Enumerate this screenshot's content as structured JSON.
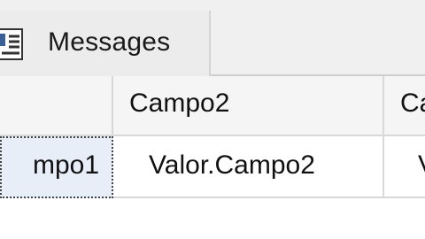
{
  "tabs": {
    "messages_label": "Messages",
    "icon": "messages-icon"
  },
  "results_grid": {
    "columns": [
      "",
      "Campo2",
      "Ca"
    ],
    "rows": [
      [
        "mpo1",
        "Valor.Campo2",
        "V"
      ]
    ]
  }
}
